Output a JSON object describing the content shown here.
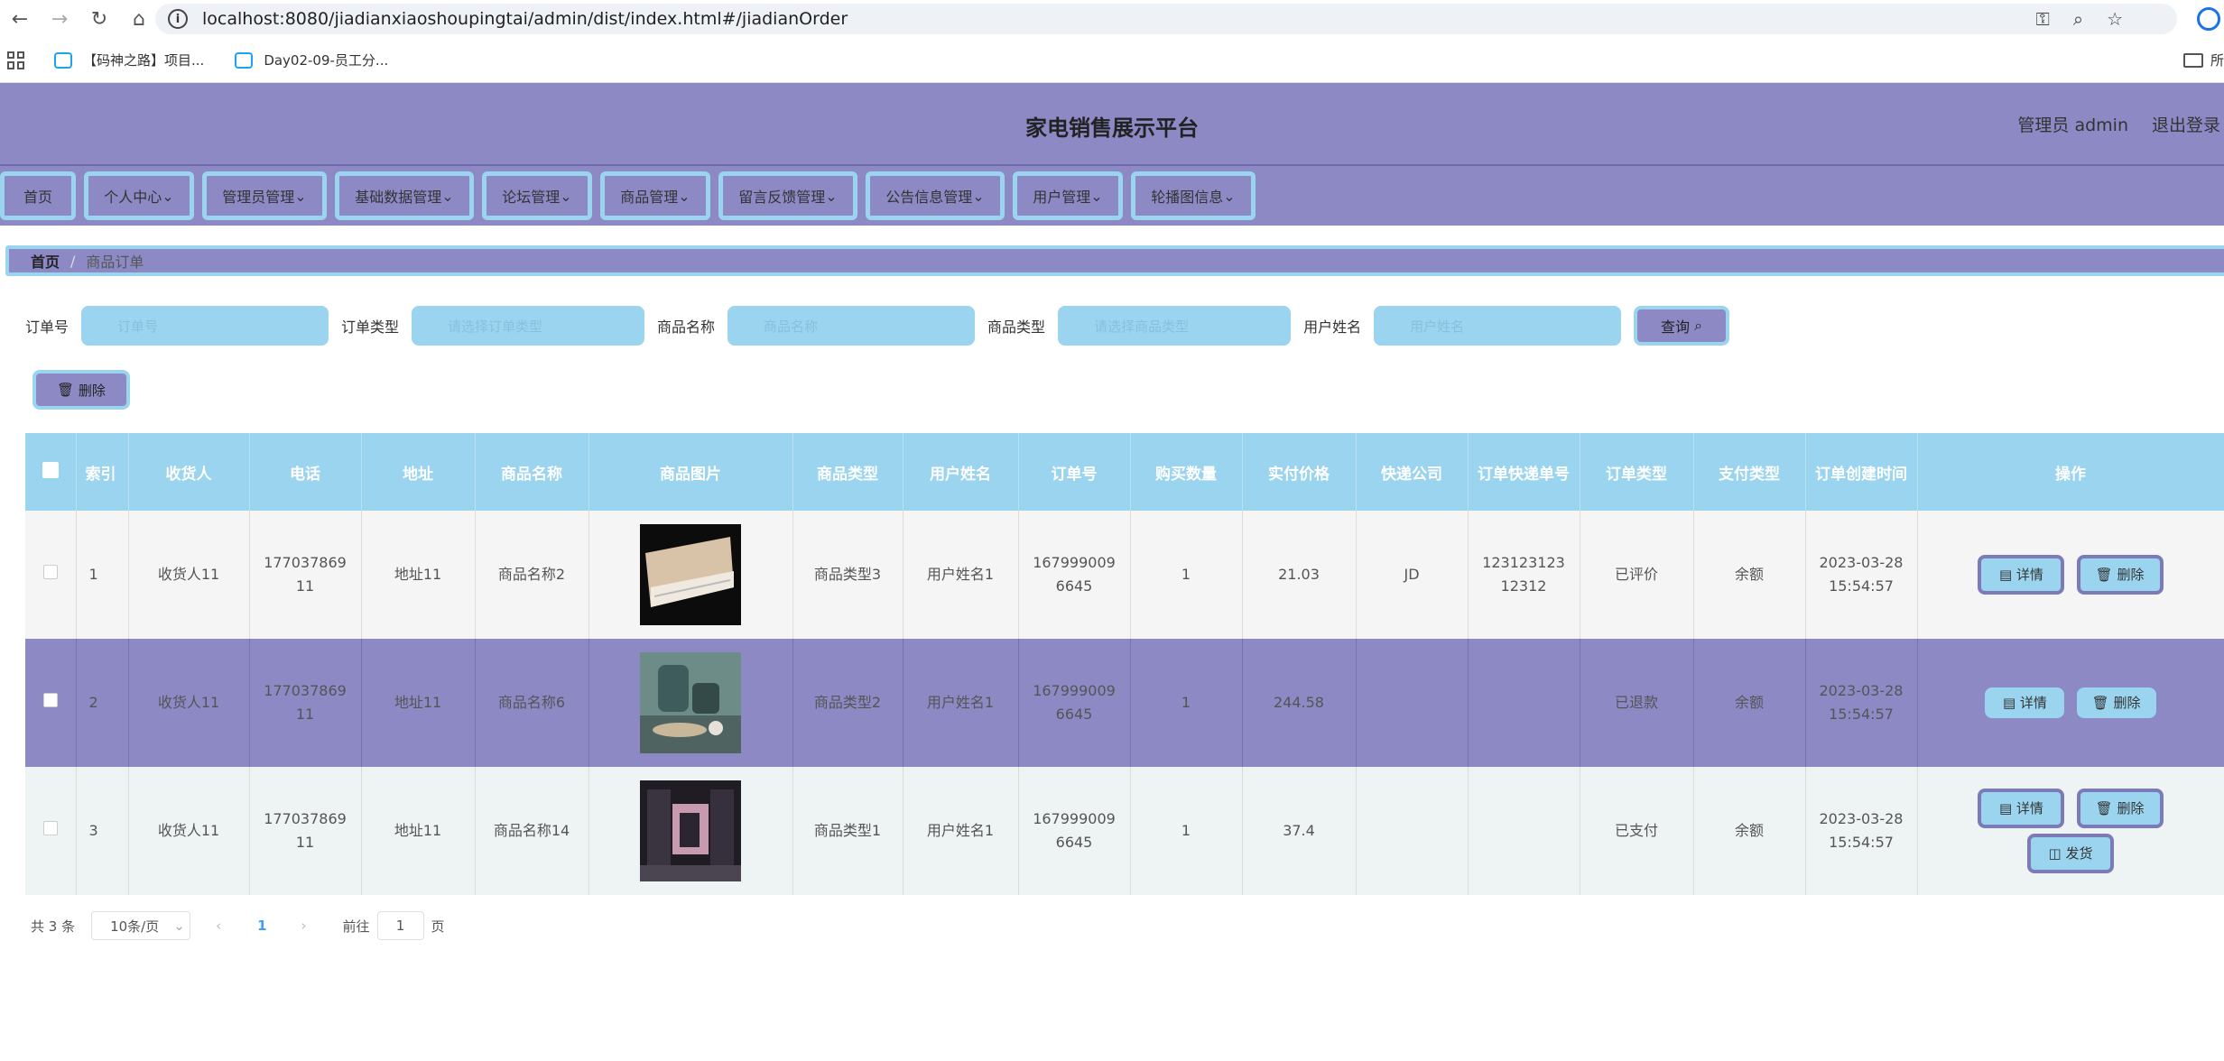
{
  "browser": {
    "url": "localhost:8080/jiadianxiaoshoupingtai/admin/dist/index.html#/jiadianOrder",
    "bookmarks": [
      "【码神之路】项目...",
      "Day02-09-员工分..."
    ],
    "bookmark_folder": "所"
  },
  "header": {
    "title": "家电销售展示平台",
    "admin_label": "管理员 admin",
    "logout_label": "退出登录"
  },
  "menu": [
    "首页",
    "个人中心",
    "管理员管理",
    "基础数据管理",
    "论坛管理",
    "商品管理",
    "留言反馈管理",
    "公告信息管理",
    "用户管理",
    "轮播图信息"
  ],
  "breadcrumb": {
    "home": "首页",
    "separator": "/",
    "current": "商品订单"
  },
  "search": {
    "fields": [
      {
        "label": "订单号",
        "placeholder": "订单号"
      },
      {
        "label": "订单类型",
        "placeholder": "请选择订单类型"
      },
      {
        "label": "商品名称",
        "placeholder": "商品名称"
      },
      {
        "label": "商品类型",
        "placeholder": "请选择商品类型"
      },
      {
        "label": "用户姓名",
        "placeholder": "用户姓名"
      }
    ],
    "query_label": "查询"
  },
  "batch_delete_label": "删除",
  "table": {
    "columns": [
      "索引",
      "收货人",
      "电话",
      "地址",
      "商品名称",
      "商品图片",
      "商品类型",
      "用户姓名",
      "订单号",
      "购买数量",
      "实付价格",
      "快递公司",
      "订单快递单号",
      "订单类型",
      "支付类型",
      "订单创建时间",
      "操作"
    ],
    "rows": [
      {
        "index": "1",
        "receiver": "收货人11",
        "phone": "17703786911",
        "address": "地址11",
        "product": "商品名称2",
        "image": "air-conditioner-photo",
        "type": "商品类型3",
        "user": "用户姓名1",
        "order_no": "1679990096645",
        "qty": "1",
        "price": "21.03",
        "courier": "JD",
        "tracking": "12312312312312",
        "status": "已评价",
        "payment": "余额",
        "created": "2023-03-28 15:54:57",
        "actions": [
          "详情",
          "删除"
        ]
      },
      {
        "index": "2",
        "receiver": "收货人11",
        "phone": "17703786911",
        "address": "地址11",
        "product": "商品名称6",
        "image": "kettle-set-photo",
        "type": "商品类型2",
        "user": "用户姓名1",
        "order_no": "1679990096645",
        "qty": "1",
        "price": "244.58",
        "courier": "",
        "tracking": "",
        "status": "已退款",
        "payment": "余额",
        "created": "2023-03-28 15:54:57",
        "actions": [
          "详情",
          "删除"
        ]
      },
      {
        "index": "3",
        "receiver": "收货人11",
        "phone": "17703786911",
        "address": "地址11",
        "product": "商品名称14",
        "image": "kitchen-interior-photo",
        "type": "商品类型1",
        "user": "用户姓名1",
        "order_no": "1679990096645",
        "qty": "1",
        "price": "37.4",
        "courier": "",
        "tracking": "",
        "status": "已支付",
        "payment": "余额",
        "created": "2023-03-28 15:54:57",
        "actions": [
          "详情",
          "删除",
          "发货"
        ]
      }
    ]
  },
  "pagination": {
    "total": "共 3 条",
    "page_size": "10条/页",
    "current": "1",
    "goto_label": "前往",
    "goto_value": "1",
    "page_suffix": "页"
  },
  "colors": {
    "primary": "#8c89c5",
    "accent": "#9ad4ef"
  }
}
